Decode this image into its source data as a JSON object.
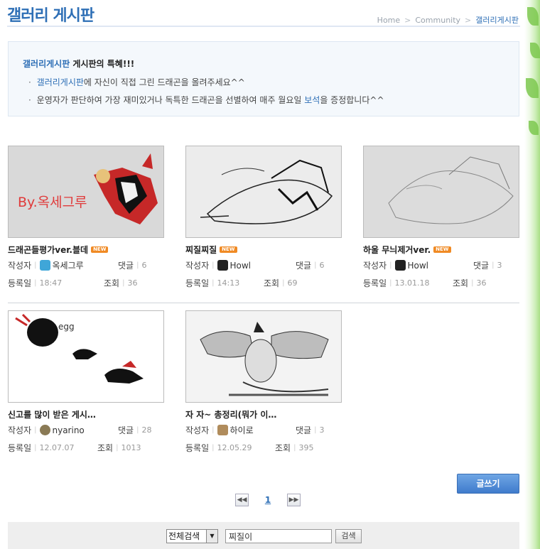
{
  "header": {
    "title": "갤러리 게시판",
    "breadcrumb": [
      "Home",
      "Community",
      "갤러리게시판"
    ]
  },
  "notice": {
    "title_highlight": "갤러리게시판",
    "title_rest": " 게시판의 특혜!!!",
    "line1_highlight": "갤러리게시판",
    "line1_rest": "에 자신이 직접 그린 드래곤을 올려주세요^^",
    "line2_before": "운영자가 판단하여 가장 재미있거나 독특한 드래곤을 선별하여 매주 월요일 ",
    "line2_highlight": "보석",
    "line2_after": "을 증정합니다^^"
  },
  "labels": {
    "author": "작성자",
    "comments": "댓글",
    "date": "등록일",
    "views": "조회",
    "new_badge": "NEW"
  },
  "posts": [
    {
      "title": "드래곤들평가ver.블데",
      "is_new": true,
      "author": "옥세그루",
      "comments": "6",
      "date": "18:47",
      "views": "36",
      "thumb_text": "By.옥세그루"
    },
    {
      "title": "찌질찌질",
      "is_new": true,
      "author": "Howl",
      "comments": "6",
      "date": "14:13",
      "views": "69"
    },
    {
      "title": "하울 무늬제거ver.",
      "is_new": true,
      "author": "Howl",
      "comments": "3",
      "date": "13.01.18",
      "views": "36"
    },
    {
      "title": "신고를 많이 받은 게시…",
      "is_new": false,
      "author": "nyarino",
      "comments": "28",
      "date": "12.07.07",
      "views": "1013",
      "thumb_text": "egg"
    },
    {
      "title": "자 자~ 총정리(뭐가 이…",
      "is_new": false,
      "author": "하이로",
      "comments": "3",
      "date": "12.05.29",
      "views": "395"
    }
  ],
  "actions": {
    "write_label": "글쓰기"
  },
  "pagination": {
    "prev_icon": "double-left-arrow",
    "current_page": "1",
    "next_icon": "double-right-arrow"
  },
  "search": {
    "scope": "전체검색",
    "query": "찌질이",
    "button_label": "검색"
  }
}
